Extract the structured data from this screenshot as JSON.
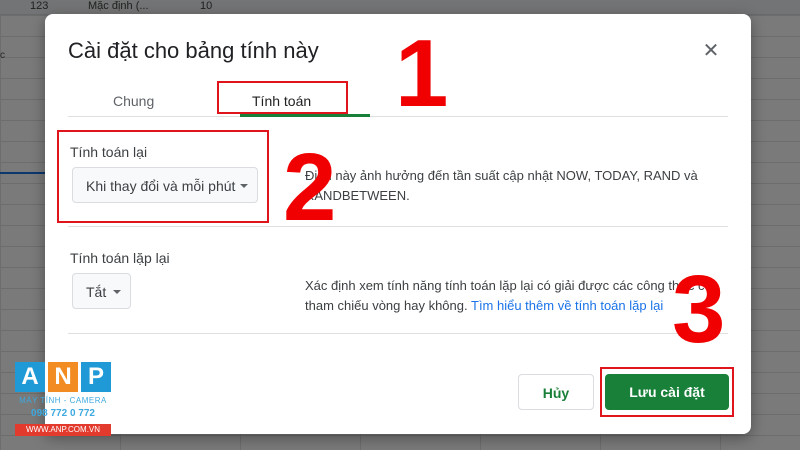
{
  "toolbar": {
    "zoom": "123",
    "font": "Mặc định (...",
    "font_size": "10"
  },
  "sheet": {
    "column_label": "c"
  },
  "dialog": {
    "title": "Cài đặt cho bảng tính này",
    "close_icon": "close-icon",
    "tabs": [
      {
        "label": "Chung"
      },
      {
        "label": "Tính toán"
      }
    ],
    "recalc": {
      "label": "Tính toán lại",
      "value": "Khi thay đổi và mỗi phút",
      "description": "Điều này ảnh hưởng đến tần suất cập nhật NOW, TODAY, RAND và RANDBETWEEN."
    },
    "iterative": {
      "label": "Tính toán lặp lại",
      "value": "Tắt",
      "description": "Xác định xem tính năng tính toán lặp lại có giải được các công thức có tham chiếu vòng hay không.",
      "link": "Tìm hiểu thêm về tính toán lặp lại"
    },
    "buttons": {
      "cancel": "Hủy",
      "save": "Lưu cài đặt"
    }
  },
  "annotations": {
    "step1": "1",
    "step2": "2",
    "step3": "3"
  },
  "logo": {
    "letters": [
      "A",
      "N",
      "P"
    ],
    "tagline": "MÁY TÍNH - CAMERA",
    "phone": "098 772 0 772",
    "website": "WWW.ANP.COM.VN"
  },
  "colors": {
    "accent": "#188038",
    "annotation": "#e0141b",
    "link": "#1a73e8"
  }
}
